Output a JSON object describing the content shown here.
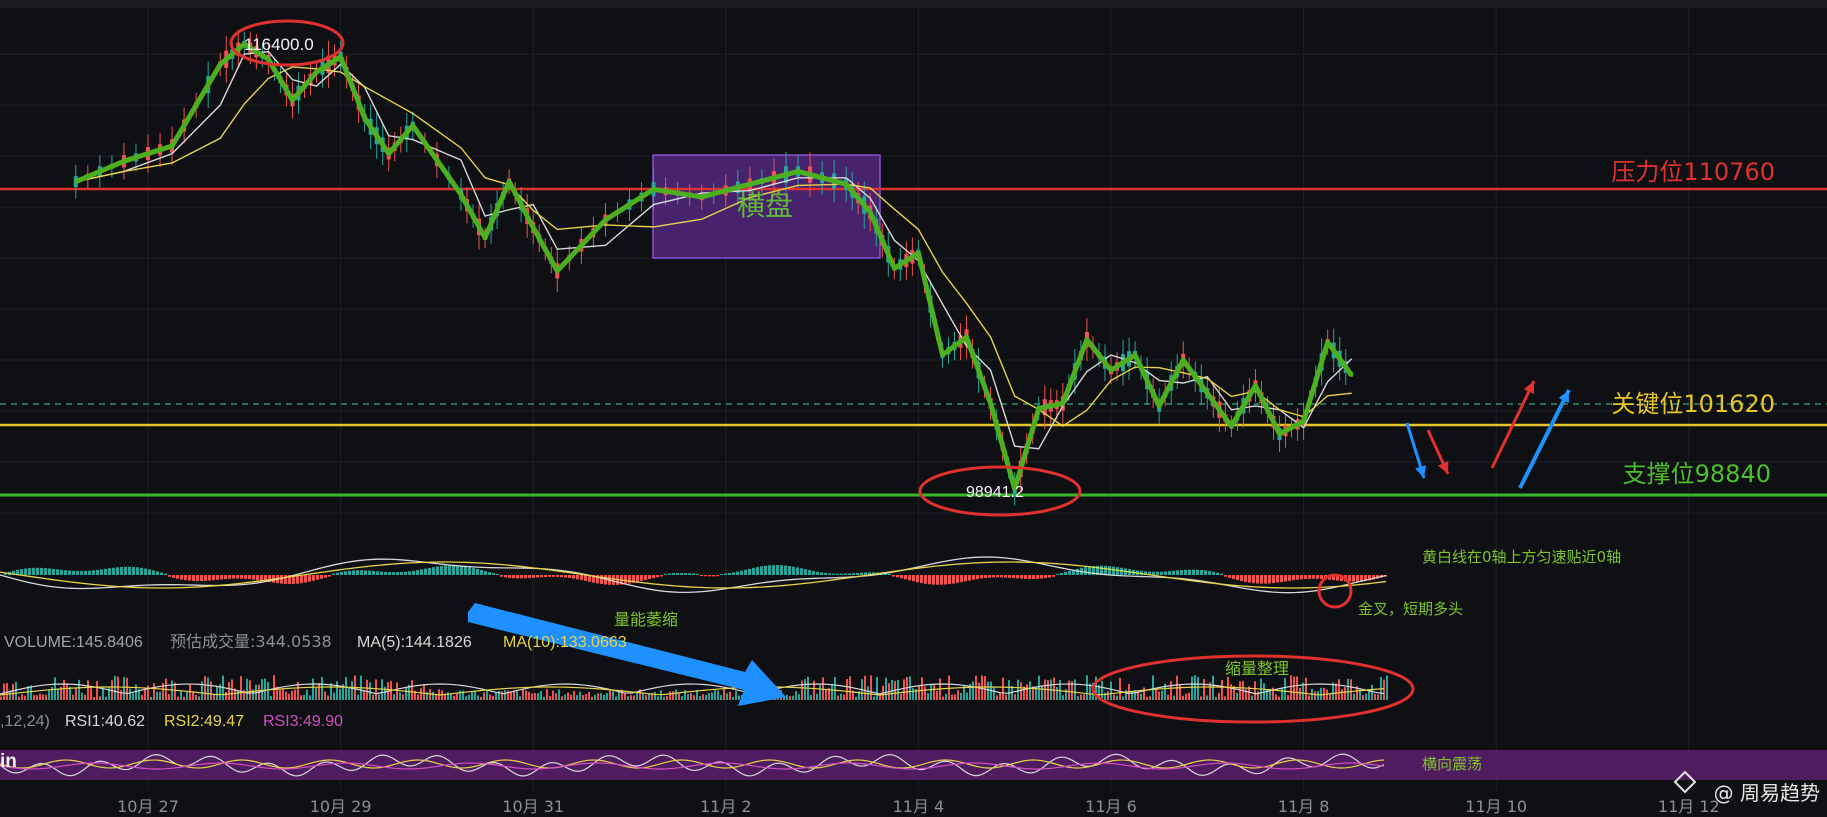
{
  "colors": {
    "background": "#0f1013",
    "grid": "#1e2128",
    "price_line": "#4caf1f",
    "resistance": "#e0312e",
    "key_level": "#e6c52a",
    "support": "#39b72a",
    "consolidation_box": "#5b2a8c",
    "up_candle": "#26a69a",
    "down_candle": "#ef5350",
    "ma_white": "#d8d8d8",
    "ma_yellow": "#e6d34a",
    "arrow_blue": "#1e90ff",
    "arrow_red": "#e0312e",
    "annotation_oval": "#e0312e",
    "rsi_band": "#5b1f6e"
  },
  "price_annotations": {
    "high_label": "116400.0",
    "low_label": "98941.2",
    "consolidation_label": "横盘"
  },
  "levels": {
    "resistance": "压力位110760",
    "key": "关键位101620",
    "support": "支撑位98840"
  },
  "macd": {
    "note1": "黄白线在0轴上方匀速贴近0轴",
    "note2": "金叉，短期多头"
  },
  "volume": {
    "volume_label": "VOLUME:145.8406",
    "estimate_label": "预估成交量:344.0538",
    "ma5_label": "MA(5):144.1826",
    "ma10_label": "MA(10):133.0663",
    "shrink_note": "量能萎缩",
    "consolidation_note": "缩量整理"
  },
  "rsi": {
    "params_label": ",12,24)",
    "rsi1_label": "RSI1:40.62",
    "rsi2_label": "RSI2:49.47",
    "rsi3_label": "RSI3:49.90",
    "note": "横向震荡",
    "side_text": "in"
  },
  "watermark": "@ 周易趋势",
  "chart_data": {
    "type": "line",
    "title": "",
    "xlabel": "",
    "ylabel": "",
    "x_ticks": [
      "10月 27",
      "10月 29",
      "10月 31",
      "11月 2",
      "11月 4",
      "11月 6",
      "11月 8",
      "11月 10",
      "11月 12"
    ],
    "ylim": [
      96000,
      120000
    ],
    "series": [
      {
        "x": [
          "10月 26 06:00",
          "10月 26 18:00",
          "10月 27 06:00",
          "10月 27 18:00",
          "10月 28 00:00",
          "10月 28 06:00",
          "10月 28 12:00",
          "10月 28 18:00",
          "10月 29 00:00",
          "10月 29 06:00",
          "10月 29 12:00",
          "10月 29 18:00",
          "10月 30 06:00",
          "10月 30 12:00",
          "10月 30 18:00",
          "10月 31 00:00",
          "10月 31 06:00",
          "10月 31 18:00",
          "11月 1 06:00",
          "11月 1 18:00",
          "11月 2 06:00",
          "11月 2 18:00",
          "11月 3 06:00",
          "11月 3 12:00",
          "11月 3 18:00",
          "11月 4 00:00",
          "11月 4 06:00",
          "11月 4 12:00",
          "11月 4 18:00",
          "11月 5 00:00",
          "11月 5 06:00",
          "11月 5 12:00",
          "11月 5 18:00",
          "11月 6 00:00",
          "11月 6 06:00",
          "11月 6 12:00",
          "11月 6 18:00",
          "11月 7 00:00",
          "11月 7 06:00",
          "11月 7 12:00",
          "11月 7 18:00",
          "11月 8 00:00",
          "11月 8 06:00",
          "11月 8 12:00"
        ],
        "values": [
          111000,
          111800,
          112400,
          115600,
          116400,
          115800,
          114200,
          115300,
          115900,
          113500,
          112100,
          113200,
          110500,
          108800,
          111000,
          109200,
          107500,
          109500,
          110700,
          110400,
          110900,
          111400,
          110900,
          109800,
          107600,
          108200,
          104200,
          104900,
          102300,
          98941,
          102100,
          102300,
          104800,
          103600,
          104200,
          102200,
          104000,
          102700,
          101400,
          103000,
          101100,
          101600,
          104700,
          103400
        ]
      }
    ]
  }
}
